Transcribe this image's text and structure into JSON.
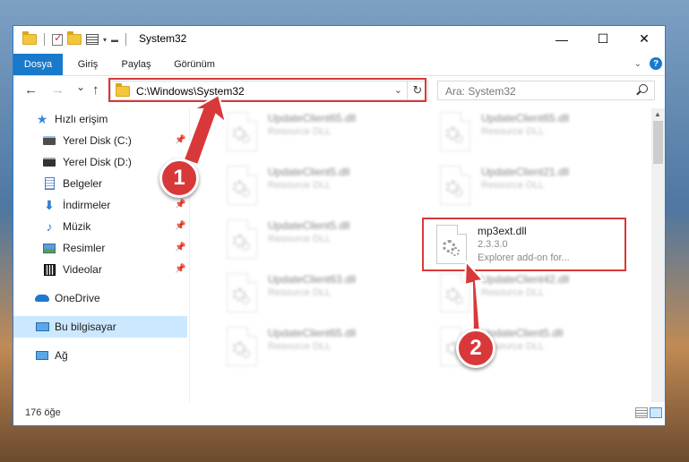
{
  "window": {
    "title": "System32",
    "controls": {
      "minimize": "—",
      "maximize": "☐",
      "close": "✕"
    }
  },
  "ribbon": {
    "tabs": [
      {
        "label": "Dosya",
        "active": true
      },
      {
        "label": "Giriş"
      },
      {
        "label": "Paylaş"
      },
      {
        "label": "Görünüm"
      }
    ],
    "help_label": "?"
  },
  "navigation": {
    "back_icon": "←",
    "forward_icon": "→",
    "recent_icon": "⌄",
    "up_icon": "↑",
    "address": "C:\\Windows\\System32",
    "refresh_icon": "↻",
    "search_placeholder": "Ara: System32"
  },
  "sidebar": {
    "items": [
      {
        "label": "Hızlı erişim",
        "icon": "star-icon"
      },
      {
        "label": "Yerel Disk (C:)",
        "icon": "drive-icon",
        "pinned": true
      },
      {
        "label": "Yerel Disk (D:)",
        "icon": "drive-icon"
      },
      {
        "label": "Belgeler",
        "icon": "document-icon"
      },
      {
        "label": "İndirmeler",
        "icon": "download-icon",
        "pinned": true
      },
      {
        "label": "Müzik",
        "icon": "music-icon",
        "pinned": true
      },
      {
        "label": "Resimler",
        "icon": "pictures-icon",
        "pinned": true
      },
      {
        "label": "Videolar",
        "icon": "video-icon",
        "pinned": true
      },
      {
        "label": "OneDrive",
        "icon": "cloud-icon"
      },
      {
        "label": "Bu bilgisayar",
        "icon": "computer-icon",
        "selected": true
      },
      {
        "label": "Ağ",
        "icon": "network-icon"
      }
    ]
  },
  "files": [
    {
      "name": "UpdateClient65.dll",
      "type": "Resource DLL",
      "blurred": true
    },
    {
      "name": "UpdateClient65.dll",
      "type": "Resource DLL",
      "blurred": true
    },
    {
      "name": "UpdateClient5.dll",
      "type": "Resource DLL",
      "blurred": true
    },
    {
      "name": "UpdateClient21.dll",
      "type": "Resource DLL",
      "blurred": true
    },
    {
      "name": "UpdateClient5.dll",
      "type": "Resource DLL",
      "blurred": true
    },
    {
      "name": "mp3ext.dll",
      "version": "2.3.3.0",
      "description": "Explorer add-on for...",
      "blurred": false
    },
    {
      "name": "UpdateClient63.dll",
      "type": "Resource DLL",
      "blurred": true
    },
    {
      "name": "UpdateClient42.dll",
      "type": "Resource DLL",
      "blurred": true
    },
    {
      "name": "UpdateClient65.dll",
      "type": "Resource DLL",
      "blurred": true
    },
    {
      "name": "UpdateClient5.dll",
      "type": "Resource DLL",
      "blurred": true
    }
  ],
  "status": {
    "item_count": "176 öğe"
  },
  "callouts": {
    "step1": "1",
    "step2": "2"
  },
  "colors": {
    "accent": "#1979ca",
    "highlight": "#d9383a",
    "selected": "#cce8ff"
  }
}
